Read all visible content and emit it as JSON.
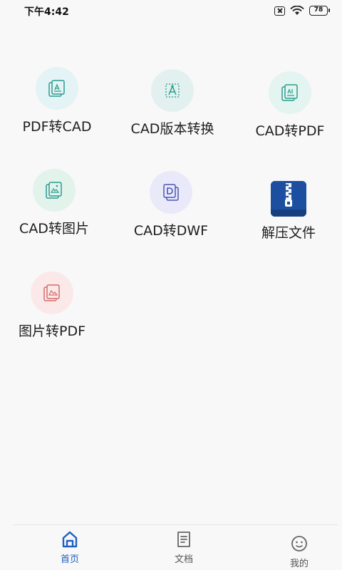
{
  "status_bar": {
    "time": "下午4:42",
    "battery": "78"
  },
  "tools": [
    {
      "label": "PDF转CAD",
      "icon": "pdf-to-cad-icon",
      "color": "#2a9d8f",
      "bg": "#e4f3f5"
    },
    {
      "label": "CAD版本转换",
      "icon": "cad-version-convert-icon",
      "color": "#2a9d8f",
      "bg": "#e2f1ef"
    },
    {
      "label": "CAD转PDF",
      "icon": "cad-to-pdf-icon",
      "color": "#2a9d8f",
      "bg": "#e4f4f0"
    },
    {
      "label": "CAD转图片",
      "icon": "cad-to-image-icon",
      "color": "#2a9d8f",
      "bg": "#e2f3ec"
    },
    {
      "label": "CAD转DWF",
      "icon": "cad-to-dwf-icon",
      "color": "#4a55b5",
      "bg": "#e9e9f9"
    },
    {
      "label": "解压文件",
      "icon": "zip-archive-icon",
      "color": "#1c4fa0",
      "bg": ""
    },
    {
      "label": "图片转PDF",
      "icon": "image-to-pdf-icon",
      "color": "#d66a6a",
      "bg": "#fbe9e9"
    }
  ],
  "bottom_nav": {
    "items": [
      {
        "label": "首页",
        "icon": "home-icon",
        "active": true
      },
      {
        "label": "文档",
        "icon": "document-icon",
        "active": false
      },
      {
        "label": "我的",
        "icon": "profile-icon",
        "active": false
      }
    ],
    "active_color": "#1f5fc2",
    "inactive_color": "#555555"
  }
}
